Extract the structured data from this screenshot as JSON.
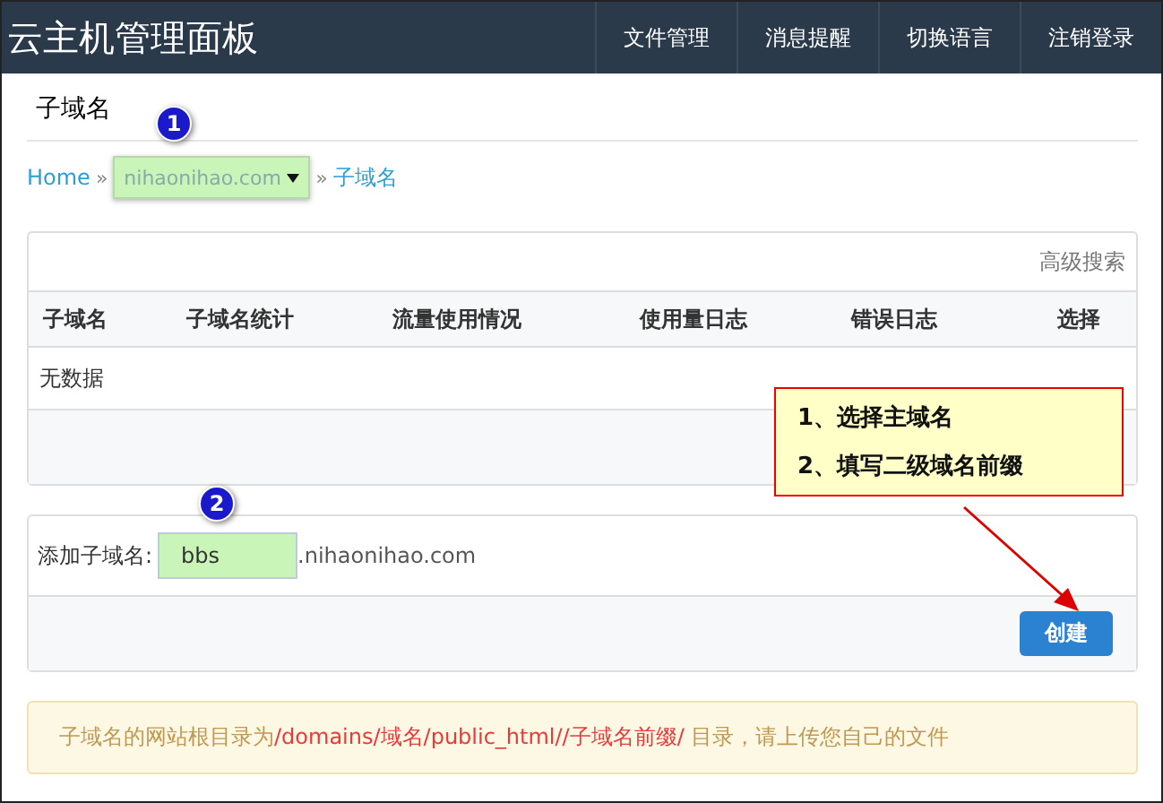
{
  "header": {
    "title": "云主机管理面板",
    "nav": [
      {
        "label": "文件管理"
      },
      {
        "label": "消息提醒"
      },
      {
        "label": "切换语言"
      },
      {
        "label": "注销登录"
      }
    ]
  },
  "page_title": "子域名",
  "breadcrumb": {
    "home": "Home",
    "separator": "»",
    "domain": "nihaonihao.com",
    "current": "子域名"
  },
  "table": {
    "search_link": "高级搜索",
    "columns": [
      "子域名",
      "子域名统计",
      "流量使用情况",
      "使用量日志",
      "错误日志",
      "选择"
    ],
    "empty": "无数据"
  },
  "add_form": {
    "label": "添加子域名:",
    "value": "bbs",
    "suffix": ".nihaonihao.com",
    "button": "创建"
  },
  "notice": [
    {
      "text": "子域名的网站根目录为",
      "highlight": false
    },
    {
      "text": "/domains/",
      "highlight": true
    },
    {
      "text": "域名",
      "highlight": true
    },
    {
      "text": "/public_html//",
      "highlight": true
    },
    {
      "text": "子域名前缀",
      "highlight": true
    },
    {
      "text": "/",
      "highlight": true
    },
    {
      "text": " 目录，请上传您自己的文件",
      "highlight": false
    }
  ],
  "annotations": {
    "markers": [
      "1",
      "2"
    ],
    "callout": [
      "1、选择主域名",
      "2、填写二级域名前缀"
    ]
  }
}
